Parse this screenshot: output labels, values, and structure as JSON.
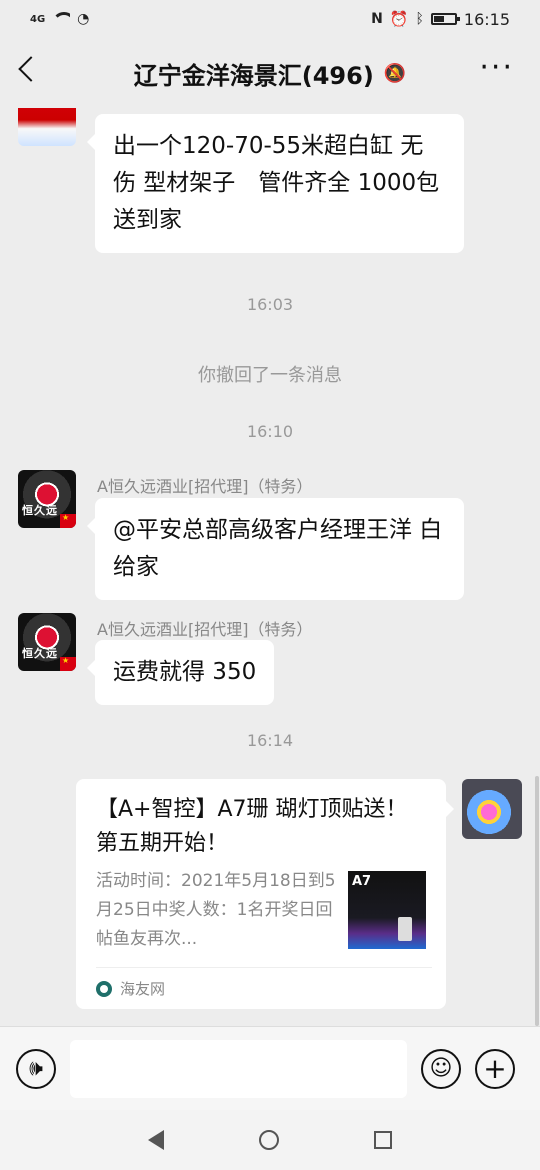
{
  "status": {
    "signal": "4G",
    "time": "16:15",
    "battery_level": 0.5
  },
  "header": {
    "title": "辽宁金洋海景汇(496)"
  },
  "messages": {
    "m1_text": "出一个120-70-55米超白缸 无伤 型材架子　管件齐全 1000包送到家",
    "ts1": "16:03",
    "recall": "你撤回了一条消息",
    "ts2": "16:10",
    "m2_sender": "A恒久远酒业[招代理]（特务）",
    "m2_text": "@平安总部高级客户经理王洋 白给家",
    "m3_sender": "A恒久远酒业[招代理]（特务）",
    "m3_text": "运费就得 350",
    "ts3": "16:14"
  },
  "link_card": {
    "title": "【A+智控】A7珊 瑚灯顶贴送！第五期开始！",
    "desc": "活动时间：2021年5月18日到5月25日中奖人数：1名开奖日回帖鱼友再次...",
    "thumb_text": "A7",
    "source": "海友网"
  },
  "input": {
    "placeholder": ""
  }
}
